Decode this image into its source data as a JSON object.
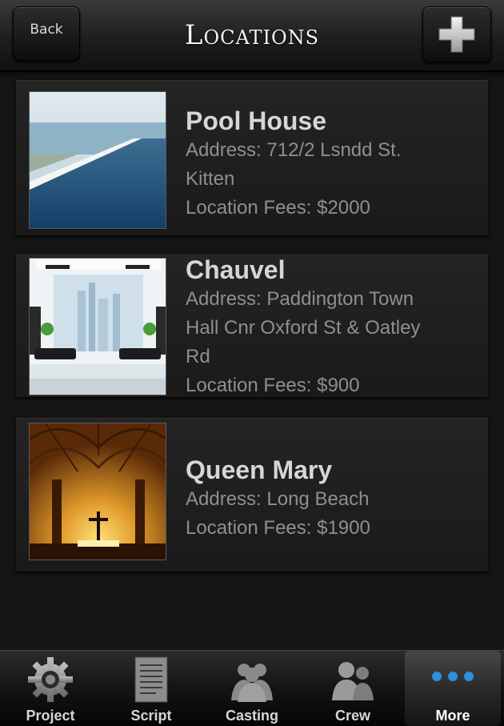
{
  "header": {
    "back_label": "Back",
    "title": "Locations",
    "add_icon": "plus-icon"
  },
  "locations": [
    {
      "name": "Pool House",
      "address_lines": [
        "Address: 712/2 Lsndd St.",
        "Kitten"
      ],
      "fees": "Location Fees: $2000",
      "thumbnail": "pool-photo"
    },
    {
      "name": "Chauvel",
      "address_lines": [
        "Address: Paddington Town",
        "Hall Cnr Oxford St & Oatley",
        "Rd"
      ],
      "fees": "Location Fees: $900",
      "thumbnail": "interior-photo"
    },
    {
      "name": "Queen Mary",
      "address_lines": [
        "Address: Long Beach"
      ],
      "fees": "Location Fees: $1900",
      "thumbnail": "cathedral-photo"
    }
  ],
  "tabbar": {
    "tabs": [
      {
        "label": "Project",
        "icon": "gear-icon",
        "active": false
      },
      {
        "label": "Script",
        "icon": "document-icon",
        "active": false
      },
      {
        "label": "Casting",
        "icon": "group-icon",
        "active": false
      },
      {
        "label": "Crew",
        "icon": "people-icon",
        "active": false
      },
      {
        "label": "More",
        "icon": "more-dots-icon",
        "active": true
      }
    ]
  },
  "colors": {
    "background": "#151515",
    "card": "#1f1f1f",
    "name_text": "#d6d6d6",
    "detail_text": "#8f8f8f",
    "more_dots": "#2f8fe0"
  }
}
